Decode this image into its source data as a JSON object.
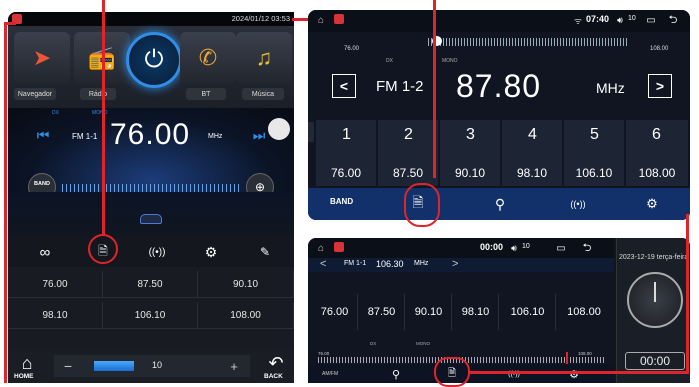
{
  "left": {
    "clock": "2024/01/12 03:53",
    "apps": [
      "Navegador",
      "Rádio",
      "BT",
      "Música"
    ],
    "dx": "DX",
    "mono": "MONO",
    "band": "FM 1-1",
    "freq": "76.00",
    "unit": "MHz",
    "band_btn": "BAND",
    "presets": [
      "76.00",
      "87.50",
      "90.10",
      "98.10",
      "106.10",
      "108.00"
    ],
    "volume": "10",
    "minus": "−",
    "plus": "+",
    "home": "HOME",
    "back": "BACK"
  },
  "right_top": {
    "time": "07:40",
    "vol": "10",
    "scale_min": "76.00",
    "scale_max": "108.00",
    "dx": "DX",
    "mono": "MONO",
    "band": "FM 1-2",
    "freq": "87.80",
    "unit": "MHz",
    "prev": "<",
    "next": ">",
    "preset_nums": [
      "1",
      "2",
      "3",
      "4",
      "5",
      "6"
    ],
    "presets": [
      "76.00",
      "87.50",
      "90.10",
      "98.10",
      "106.10",
      "108.00"
    ],
    "band_btn": "BAND"
  },
  "right_bottom": {
    "time": "00:00",
    "vol": "10",
    "band": "FM 1-1",
    "freq": "106.30",
    "unit": "MHz",
    "presets": [
      "76.00",
      "87.50",
      "90.10",
      "98.10",
      "106.10",
      "108.00"
    ],
    "scale_min": "76.00",
    "scale_max": "108.00",
    "dx": "DX",
    "mono": "MONO",
    "date": "2023-12-19 terça-feira",
    "clock": "00:00",
    "amfm": "AM/FM"
  },
  "colors": {
    "accent": "#2f8fe8",
    "highlight": "#e0242b"
  }
}
